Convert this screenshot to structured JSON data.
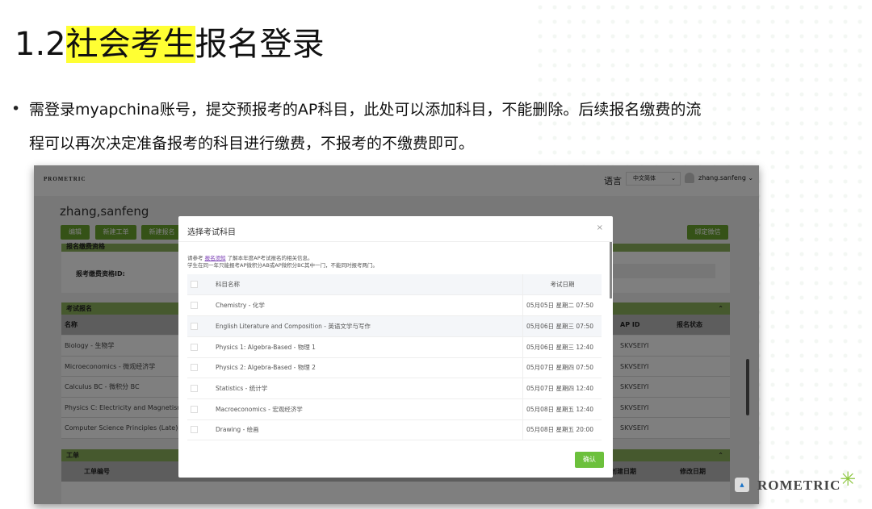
{
  "slide": {
    "title_prefix": "1.2",
    "title_highlight": "社会考生",
    "title_suffix": "报名登录",
    "bullet_line1": "需登录myapchina账号，提交预报考的AP科目，此处可以添加科目，不能删除。后续报名缴费的流",
    "bullet_line2": "程可以再次决定准备报考的科目进行缴费，不报考的不缴费即可。",
    "footer_logo": "ROMETRIC"
  },
  "header": {
    "logo": "PROMETRIC",
    "language_label": "语言",
    "language_value": "中文简体",
    "user": "zhang.sanfeng"
  },
  "profile": {
    "name": "zhang,sanfeng",
    "buttons": [
      "编辑",
      "新建工单",
      "新建报名"
    ],
    "wechat_button": "绑定微信"
  },
  "qualification": {
    "title": "报名缴费资格",
    "id_label": "报考缴费资格ID:"
  },
  "exam_reg": {
    "title": "考试报名",
    "columns": [
      "名称",
      "AP ID",
      "报名状态"
    ],
    "rows": [
      {
        "name": "Biology - 生物学",
        "apid": "SKVSEIYI"
      },
      {
        "name": "Microeconomics - 微观经济学",
        "apid": "SKVSEIYI"
      },
      {
        "name": "Calculus BC - 微积分 BC",
        "apid": "SKVSEIYI"
      },
      {
        "name": "Physics C: Electricity and Magnetism - 物",
        "apid": "SKVSEIYI"
      },
      {
        "name": "Computer Science Principles (Late) - 计算",
        "apid": "SKVSEIYI"
      }
    ]
  },
  "tickets": {
    "title": "工单",
    "columns": [
      "工单编号",
      "创建日期",
      "修改日期"
    ]
  },
  "modal": {
    "title": "选择考试科目",
    "note_prefix": "请参考",
    "note_link": "报名须知",
    "note_suffix": "了解本年度AP考试报名的相关信息。",
    "note_line2": "学生在同一年只能报考AP微积分AB或AP微积分BC其中一门，不能同时报考两门。",
    "columns": [
      "科目名称",
      "考试日期"
    ],
    "rows": [
      {
        "name": "Chemistry - 化学",
        "date": "05月05日 星期二 07:50"
      },
      {
        "name": "English Literature and Composition - 英语文学与写作",
        "date": "05月06日 星期三 07:50"
      },
      {
        "name": "Physics 1: Algebra-Based - 物理 1",
        "date": "05月06日 星期三 12:40"
      },
      {
        "name": "Physics 2: Algebra-Based - 物理 2",
        "date": "05月07日 星期四 07:50"
      },
      {
        "name": "Statistics - 统计学",
        "date": "05月07日 星期四 12:40"
      },
      {
        "name": "Macroeconomics - 宏观经济学",
        "date": "05月08日 星期五 12:40"
      },
      {
        "name": "Drawing - 绘画",
        "date": "05月08日 星期五 20:00"
      }
    ],
    "confirm": "确认"
  },
  "colors": {
    "accent_green": "#6aa52e",
    "highlight": "#ffff33",
    "link": "#7b3fb5"
  }
}
